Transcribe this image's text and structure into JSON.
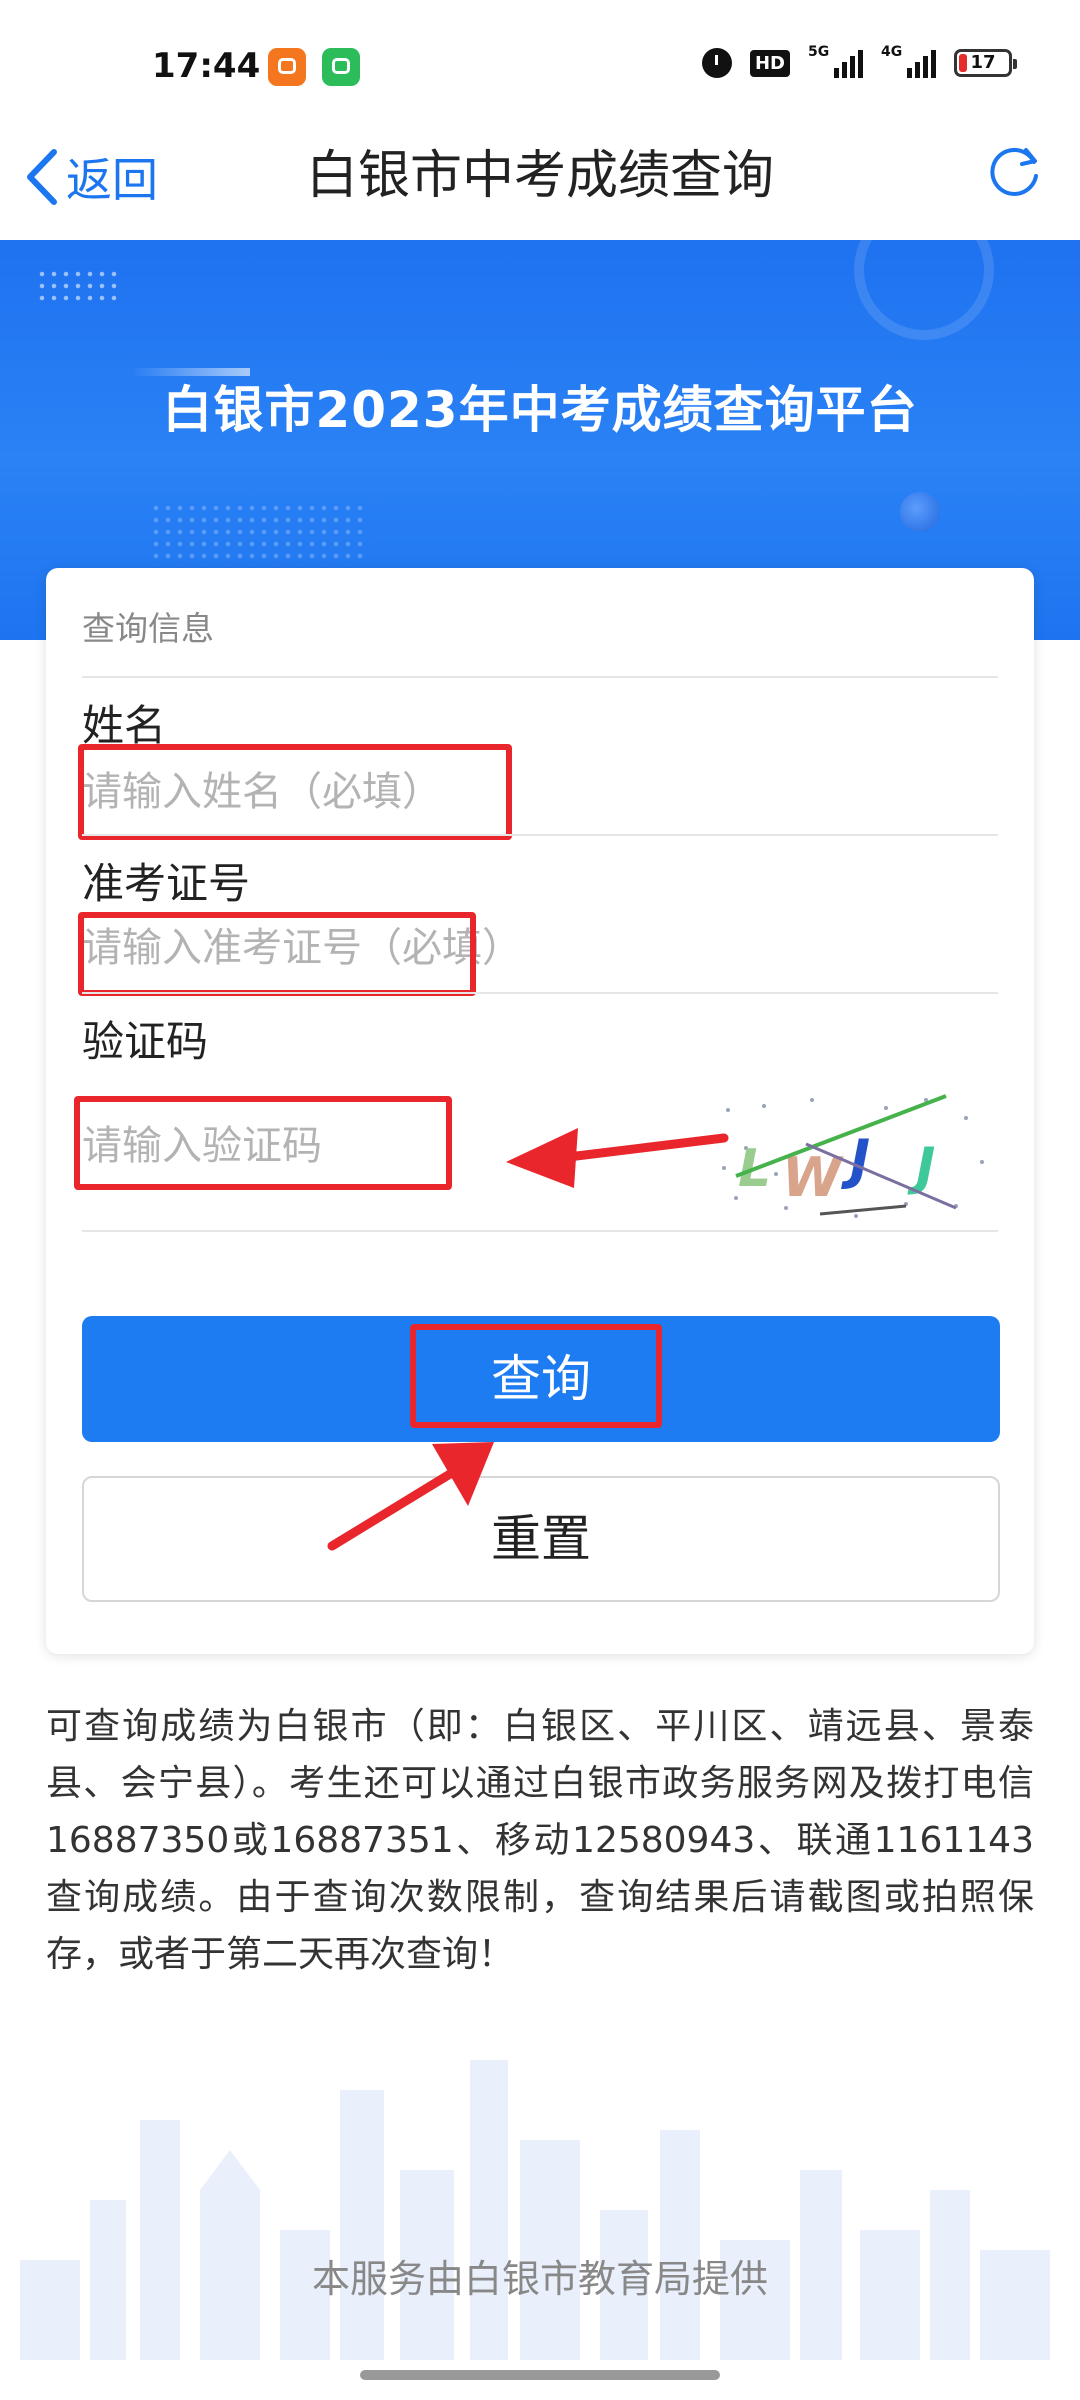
{
  "status_bar": {
    "time": "17:44",
    "hd_label": "HD",
    "signal1_label": "5G",
    "signal2_label": "4G",
    "battery": "17"
  },
  "nav": {
    "back_label": "返回",
    "title": "白银市中考成绩查询"
  },
  "banner": {
    "title": "白银市2023年中考成绩查询平台"
  },
  "form": {
    "section_title": "查询信息",
    "name_label": "姓名",
    "name_placeholder": "请输入姓名（必填）",
    "ticket_label": "准考证号",
    "ticket_placeholder": "请输入准考证号（必填）",
    "captcha_label": "验证码",
    "captcha_placeholder": "请输入验证码",
    "captcha_text": "LWJJ",
    "query_button": "查询",
    "reset_button": "重置"
  },
  "description": "可查询成绩为白银市（即：白银区、平川区、靖远县、景泰县、会宁县）。考生还可以通过白银市政务服务网及拨打电信16887350或16887351、移动12580943、联通1161143查询成绩。由于查询次数限制，查询结果后请截图或拍照保存，或者于第二天再次查询！",
  "footer": "本服务由白银市教育局提供",
  "colors": {
    "accent": "#1d7cf2",
    "annotation_red": "#e8262b",
    "banner_blue": "#2a82f5"
  }
}
